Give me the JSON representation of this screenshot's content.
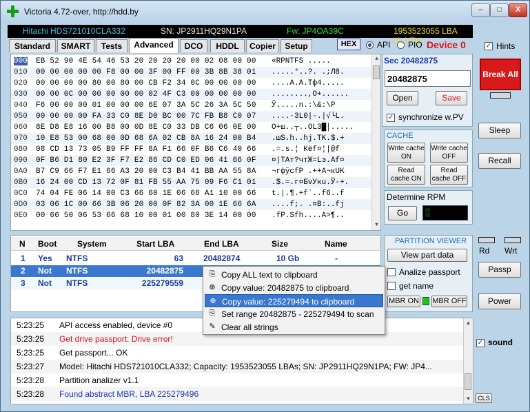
{
  "window": {
    "title": "Victoria 4.72-over, http://hdd.by",
    "min_label": "–",
    "max_label": "□",
    "close_label": "X"
  },
  "drive": {
    "model": "Hitachi HDS721010CLA332",
    "sn": "SN: JP2911HQ29N1PA",
    "fw": "Fw: JP4OA39C",
    "lba": "1953523055 LBA (1,0 Tb)"
  },
  "tabs": [
    "Standard",
    "SMART",
    "Tests",
    "Advanced",
    "DCO",
    "HDDL",
    "Copier",
    "Setup"
  ],
  "toolbar": {
    "hex": "HEX",
    "api": "API",
    "pio": "PIO",
    "device": "Device 0",
    "hints": "Hints",
    "hints_mark": "✓"
  },
  "hex_rows": [
    {
      "off": "000",
      "bytes": "EB 52 90 4E 54 46 53 20 20 20 20 00 02 08 00 00",
      "ascii": "«RPNTFS      ....."
    },
    {
      "off": "010",
      "bytes": "00 00 00 00 00 F8 00 00 3F 00 FF 00 3B 8B 38 01",
      "ascii": ".....°..?. .;Л8."
    },
    {
      "off": "020",
      "bytes": "00 00 00 00 80 00 80 00 CB F2 34 0C 00 00 00 00",
      "ascii": "....А.А.Тф4....."
    },
    {
      "off": "030",
      "bytes": "00 00 0C 00 00 00 00 00 02 4F C3 00 00 00 00 00",
      "ascii": "........,O+......"
    },
    {
      "off": "040",
      "bytes": "F6 00 00 00 01 00 00 00 6E 07 3A 5C 26 3A 5C 50",
      "ascii": "Ў.....n.:\\&:\\P"
    },
    {
      "off": "050",
      "bytes": "00 00 00 00 FA 33 C0 8E D0 BC 00 7C FB B8 C0 07",
      "ascii": "....·3L0|-.|√└L."
    },
    {
      "off": "060",
      "bytes": "8E D8 E8 16 00 B8 00 0D 8E C0 33 DB C6 06 0E 00",
      "ascii": "O+ш..┬..OL3█│....."
    },
    {
      "off": "070",
      "bytes": "10 E8 53 00 68 00 0D 68 6A 02 CB 8A 16 24 00 B4",
      "ascii": ".шS.h..hj.TK.$.+"
    },
    {
      "off": "080",
      "bytes": "08 CD 13 73 05 B9 FF FF 8A F1 66 0F B6 C6 40 66",
      "ascii": ".=.s.¦  Кёf¤¦|@f"
    },
    {
      "off": "090",
      "bytes": "0F B6 D1 80 E2 3F F7 E2 86 CD C0 ED 06 41 66 0F",
      "ascii": "¤|TАт?чтЖ=Lэ.Af¤"
    },
    {
      "off": "0A0",
      "bytes": "B7 C9 66 F7 E1 66 A3 20 00 C3 B4 41 BB AA 55 8A",
      "ascii": "¬rфўсfP .++A¬кUK"
    },
    {
      "off": "0B0",
      "bytes": "16 24 00 CD 13 72 0F 81 FB 55 AA 75 09 F6 C1 01",
      "ascii": ".$.=.r¤БvУкu.Ў-+."
    },
    {
      "off": "0C0",
      "bytes": "74 04 FE 06 14 00 C3 66 60 1E 06 66 A1 10 00 66",
      "ascii": "t.|.¶.+f`..f6..f"
    },
    {
      "off": "0D0",
      "bytes": "03 06 1C 00 66 3B 06 20 00 0F 82 3A 00 1E 66 6A",
      "ascii": "....f;. .¤В:..fj"
    },
    {
      "off": "0E0",
      "bytes": "00 66 50 06 53 66 68 10 00 01 00 80 3E 14 00 00",
      "ascii": ".fP.Sfh....А>¶.."
    }
  ],
  "sector": {
    "title": "Sec 20482875",
    "value": "20482875",
    "open": "Open",
    "save": "Save",
    "sync": "synchronize w.PV",
    "sync_mark": "✓"
  },
  "cache": {
    "title": "CACHE",
    "write_on": "Write cache ON",
    "write_off": "Write cache OFF",
    "read_on": "Read cache ON",
    "read_off": "Read cache OFF"
  },
  "rpm": {
    "title": "Determine RPM",
    "go": "Go",
    "display": "▒"
  },
  "right_panel": {
    "break_all": "Break All",
    "sleep": "Sleep",
    "recall": "Recall",
    "rd": "Rd",
    "wrt": "Wrt",
    "passp": "Passp",
    "power": "Power",
    "sound": "sound",
    "sound_mark": "✓",
    "cls": "CLS"
  },
  "partitions": {
    "headers": [
      "N",
      "Boot",
      "System",
      "Start LBA",
      "End LBA",
      "Size",
      "Name"
    ],
    "rows": [
      {
        "n": "1",
        "boot": "Yes",
        "system": "NTFS",
        "start": "63",
        "end": "20482874",
        "size": "10 Gb",
        "name": "-"
      },
      {
        "n": "2",
        "boot": "Not",
        "system": "NTFS",
        "start": "20482875",
        "end": "2",
        "size": "",
        "name": ""
      },
      {
        "n": "3",
        "boot": "Not",
        "system": "NTFS",
        "start": "225279559",
        "end": "19",
        "size": "",
        "name": ""
      }
    ]
  },
  "partition_viewer": {
    "title": "PARTITION VIEWER",
    "view": "View part data",
    "analize": "Analize passport",
    "get_name": "get name",
    "mbr_on": "MBR ON",
    "mbr_off": "MBR OFF"
  },
  "context_menu": [
    {
      "icon": "⎘",
      "label": "Copy ALL text to clipboard"
    },
    {
      "icon": "⊕",
      "label": "Copy value: 20482875 to clipboard"
    },
    {
      "icon": "⊕",
      "label": "Copy value: 225279494 to clipboard"
    },
    {
      "icon": "⎘",
      "label": "Set range 20482875 - 225279494 to scan"
    },
    {
      "icon": "✎",
      "label": "Clear all strings"
    }
  ],
  "log": [
    {
      "time": "5:23:25",
      "msg": "API access enabled, device #0",
      "color": "black"
    },
    {
      "time": "5:23:25",
      "msg": "Get drive passport: Drive error!",
      "color": "red"
    },
    {
      "time": "5:23:25",
      "msg": "Get passport... OK",
      "color": "black"
    },
    {
      "time": "5:23:27",
      "msg": "Model: Hitachi HDS721010CLA332; Capacity: 1953523055 LBAs; SN: JP2911HQ29N1PA; FW: JP4...",
      "color": "black"
    },
    {
      "time": "5:23:28",
      "msg": "Partition analizer v1.1",
      "color": "black"
    },
    {
      "time": "5:23:28",
      "msg": "Found abstract MBR, LBA 225279496",
      "color": "blue"
    }
  ]
}
